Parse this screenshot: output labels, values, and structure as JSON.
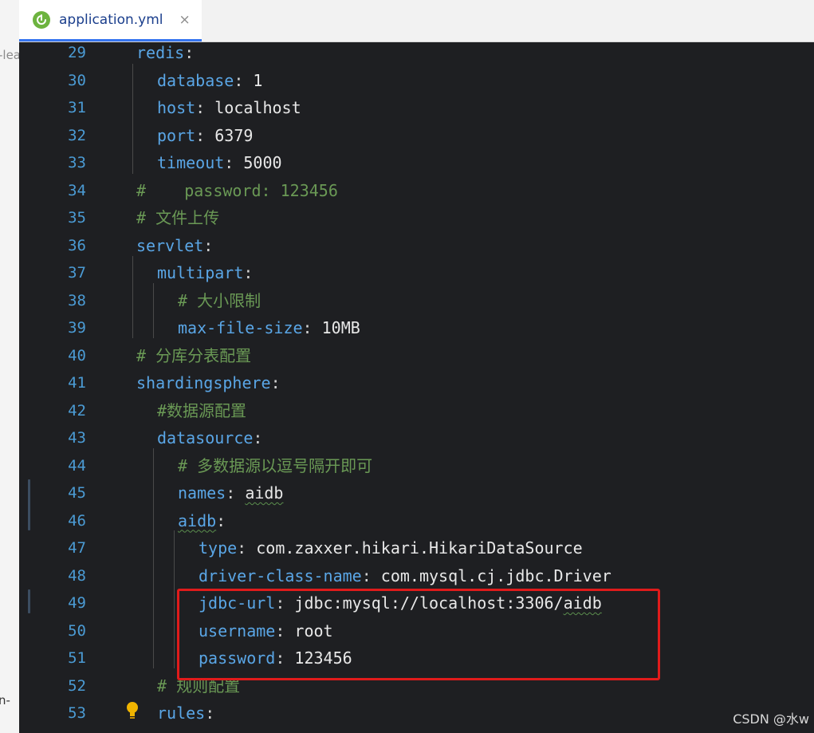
{
  "tab": {
    "filename": "application.yml",
    "close": "×",
    "icon": "spring-leaf-icon"
  },
  "left_fragments": {
    "top": "-lea",
    "bottom": "n-"
  },
  "watermark": "CSDN @水w",
  "lines": [
    {
      "num": "29",
      "parts": [
        [
          "k",
          "redis"
        ],
        [
          "p",
          ":"
        ]
      ]
    },
    {
      "num": "30",
      "parts": [
        [
          "k",
          "database"
        ],
        [
          "p",
          ": "
        ],
        [
          "v",
          "1"
        ]
      ]
    },
    {
      "num": "31",
      "parts": [
        [
          "k",
          "host"
        ],
        [
          "p",
          ": "
        ],
        [
          "v",
          "localhost"
        ]
      ]
    },
    {
      "num": "32",
      "parts": [
        [
          "k",
          "port"
        ],
        [
          "p",
          ": "
        ],
        [
          "v",
          "6379"
        ]
      ]
    },
    {
      "num": "33",
      "parts": [
        [
          "k",
          "timeout"
        ],
        [
          "p",
          ": "
        ],
        [
          "v",
          "5000"
        ]
      ]
    },
    {
      "num": "34",
      "parts": [
        [
          "c",
          "#    password: 123456"
        ]
      ]
    },
    {
      "num": "35",
      "parts": [
        [
          "c",
          "# 文件上传"
        ]
      ]
    },
    {
      "num": "36",
      "parts": [
        [
          "k",
          "servlet"
        ],
        [
          "p",
          ":"
        ]
      ]
    },
    {
      "num": "37",
      "parts": [
        [
          "k",
          "multipart"
        ],
        [
          "p",
          ":"
        ]
      ]
    },
    {
      "num": "38",
      "parts": [
        [
          "c",
          "# 大小限制"
        ]
      ]
    },
    {
      "num": "39",
      "parts": [
        [
          "k",
          "max-file-size"
        ],
        [
          "p",
          ": "
        ],
        [
          "v",
          "10MB"
        ]
      ]
    },
    {
      "num": "40",
      "parts": [
        [
          "c",
          "# 分库分表配置"
        ]
      ]
    },
    {
      "num": "41",
      "parts": [
        [
          "k",
          "shardingsphere"
        ],
        [
          "p",
          ":"
        ]
      ]
    },
    {
      "num": "42",
      "parts": [
        [
          "c",
          "#数据源配置"
        ]
      ]
    },
    {
      "num": "43",
      "parts": [
        [
          "k",
          "datasource"
        ],
        [
          "p",
          ":"
        ]
      ]
    },
    {
      "num": "44",
      "parts": [
        [
          "c",
          "# 多数据源以逗号隔开即可"
        ]
      ]
    },
    {
      "num": "45",
      "parts": [
        [
          "k",
          "names"
        ],
        [
          "p",
          ": "
        ],
        [
          "vw",
          "aidb"
        ]
      ]
    },
    {
      "num": "46",
      "parts": [
        [
          "kw",
          "aidb"
        ],
        [
          "p",
          ":"
        ]
      ]
    },
    {
      "num": "47",
      "parts": [
        [
          "k",
          "type"
        ],
        [
          "p",
          ": "
        ],
        [
          "v",
          "com.zaxxer.hikari.HikariDataSource"
        ]
      ]
    },
    {
      "num": "48",
      "parts": [
        [
          "k",
          "driver-class-name"
        ],
        [
          "p",
          ": "
        ],
        [
          "v",
          "com.mysql.cj.jdbc.Driver"
        ]
      ]
    },
    {
      "num": "49",
      "parts": [
        [
          "k",
          "jdbc-url"
        ],
        [
          "p",
          ": "
        ],
        [
          "v",
          "jdbc:mysql://localhost:3306/"
        ],
        [
          "vw",
          "aidb"
        ]
      ]
    },
    {
      "num": "50",
      "parts": [
        [
          "k",
          "username"
        ],
        [
          "p",
          ": "
        ],
        [
          "v",
          "root"
        ]
      ]
    },
    {
      "num": "51",
      "parts": [
        [
          "k",
          "password"
        ],
        [
          "p",
          ": "
        ],
        [
          "v",
          "123456"
        ]
      ]
    },
    {
      "num": "52",
      "parts": [
        [
          "c",
          "# 规则配置"
        ]
      ]
    },
    {
      "num": "53",
      "parts": [
        [
          "k",
          "rules"
        ],
        [
          "p",
          ":"
        ]
      ]
    }
  ]
}
